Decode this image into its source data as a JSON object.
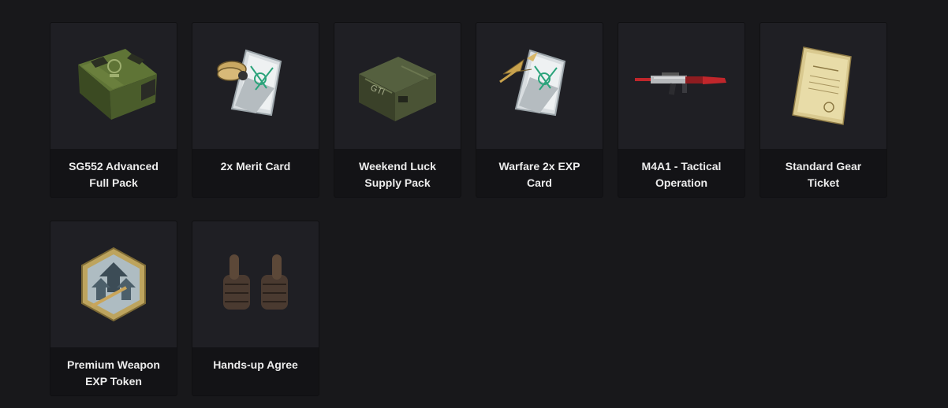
{
  "items": [
    {
      "name": "SG552 Advanced Full Pack",
      "icon": "green-crate-icon"
    },
    {
      "name": "2x Merit Card",
      "icon": "merit-card-icon"
    },
    {
      "name": "Weekend Luck Supply Pack",
      "icon": "supply-case-icon"
    },
    {
      "name": "Warfare 2x EXP Card",
      "icon": "exp-card-icon"
    },
    {
      "name": "M4A1 - Tactical Operation",
      "icon": "rifle-icon"
    },
    {
      "name": "Standard Gear Ticket",
      "icon": "ticket-scroll-icon"
    },
    {
      "name": "Premium Weapon EXP Token",
      "icon": "weapon-exp-token-icon"
    },
    {
      "name": "Hands-up Agree",
      "icon": "thumbs-up-icon"
    }
  ]
}
